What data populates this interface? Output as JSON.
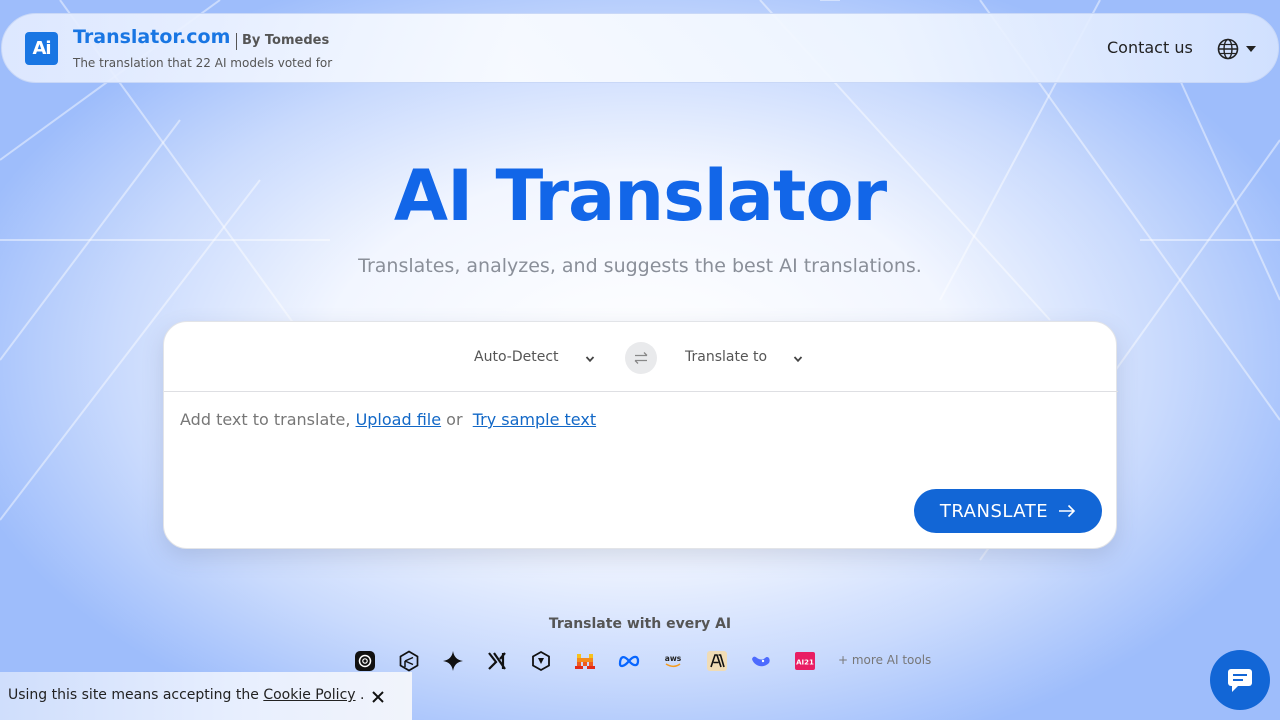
{
  "header": {
    "brand_name": "Translator.com",
    "brand_by": "By Tomedes",
    "tagline": "The translation that 22 AI models voted for",
    "logo_text": "Ai",
    "contact_label": "Contact us",
    "language_icon": "globe-icon"
  },
  "hero": {
    "title": "AI Translator",
    "subtitle": "Translates, analyzes, and suggests the best AI translations."
  },
  "translator": {
    "source_language": "Auto-Detect",
    "target_language": "Translate to",
    "swap_icon": "swap-arrows-icon",
    "input_prompt": "Add text to translate,",
    "upload_link": "Upload file",
    "or_text": "or",
    "sample_link": "Try sample text",
    "translate_label": "TRANSLATE"
  },
  "ai_tools": {
    "title": "Translate with every AI",
    "icons": [
      "chatgpt-icon",
      "perplexity-icon",
      "gemini-icon",
      "grok-icon",
      "qwen-icon",
      "mistral-icon",
      "meta-icon",
      "aws-icon",
      "anthropic-icon",
      "deepseek-icon",
      "ai21-icon"
    ],
    "more_label": "+ more AI tools"
  },
  "cookie": {
    "text": "Using this site means accepting the",
    "link": "Cookie Policy",
    "period": "."
  },
  "colors": {
    "accent": "#1266d6",
    "brand": "#1976e3",
    "title": "#1266e8"
  }
}
